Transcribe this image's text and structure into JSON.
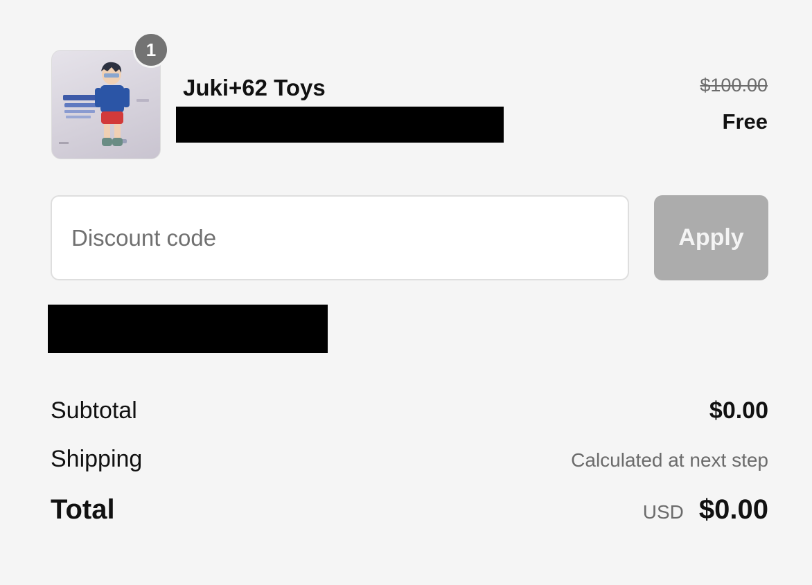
{
  "product": {
    "name": "Juki+62 Toys",
    "quantity": "1",
    "original_price": "$100.00",
    "price": "Free",
    "image_icon": "toy-figure-product-image"
  },
  "discount": {
    "placeholder": "Discount code",
    "apply_label": "Apply"
  },
  "summary": {
    "subtotal_label": "Subtotal",
    "subtotal_value": "$0.00",
    "shipping_label": "Shipping",
    "shipping_value": "Calculated at next step",
    "total_label": "Total",
    "currency": "USD",
    "total_value": "$0.00"
  },
  "colors": {
    "background": "#f5f5f5",
    "apply_button_disabled": "#acacac",
    "badge": "#737373",
    "muted_text": "#6b6b6b"
  }
}
